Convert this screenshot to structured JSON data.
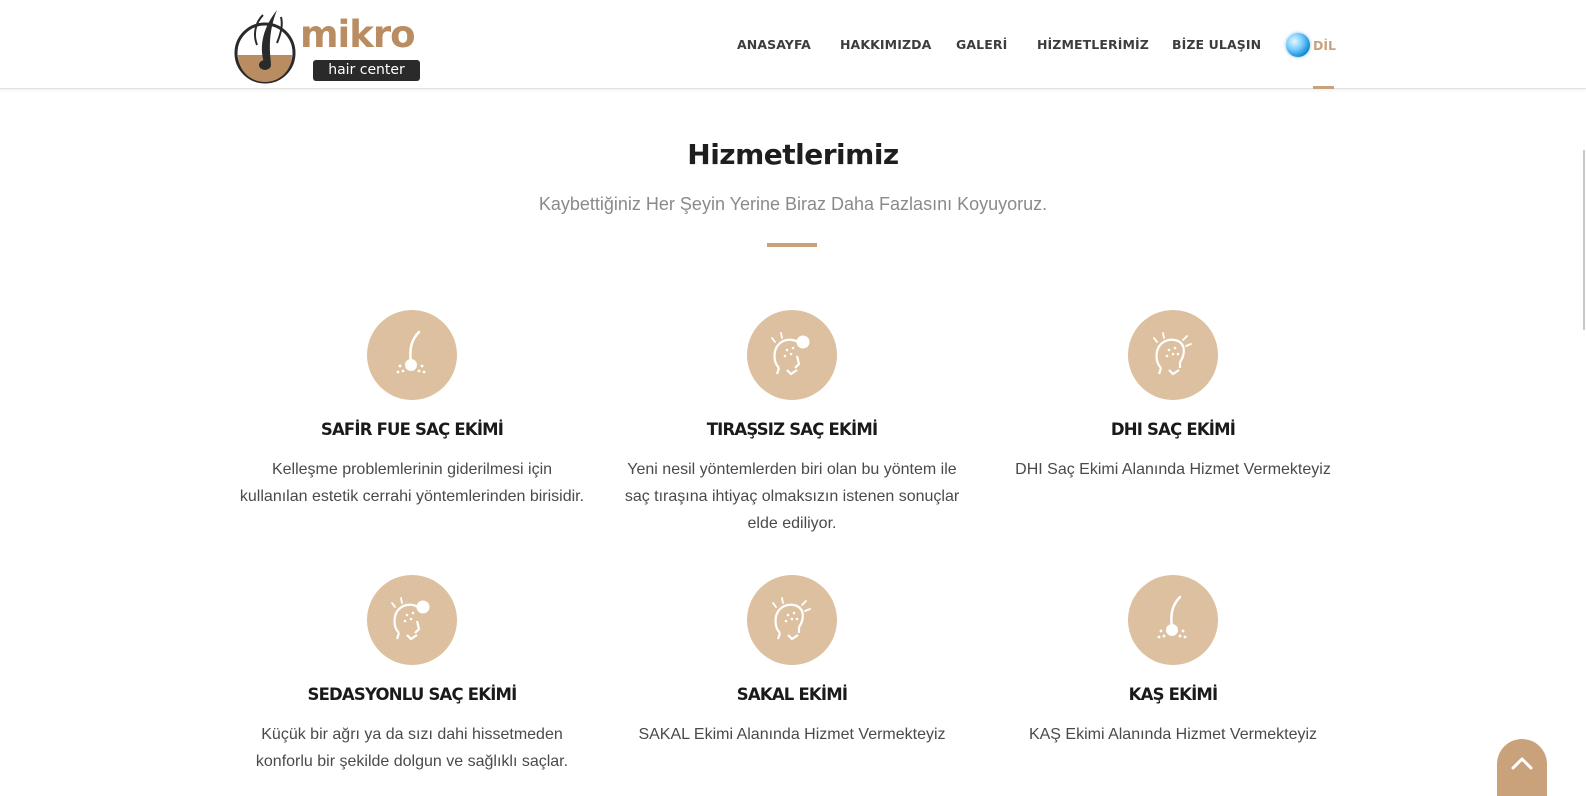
{
  "header": {
    "logo": {
      "word": "mikro",
      "tagline": "hair center"
    },
    "nav": [
      {
        "label": "ANASAYFA"
      },
      {
        "label": "HAKKIMIZDA"
      },
      {
        "label": "GALERİ"
      },
      {
        "label": "HİZMETLERİMİZ"
      },
      {
        "label": "BİZE ULAŞIN"
      }
    ],
    "language": {
      "label": "DİL",
      "icon": "globe-icon"
    }
  },
  "section": {
    "title": "Hizmetlerimiz",
    "subtitle": "Kaybettiğiniz Her Şeyin Yerine Biraz Daha Fazlasını Koyuyoruz."
  },
  "services": [
    {
      "title": "SAFİR FUE SAÇ EKİMİ",
      "description": "Kelleşme problemlerinin giderilmesi için kullanılan estetik cerrahi yöntemlerinden birisidir.",
      "icon": "hair-follicle-icon"
    },
    {
      "title": "TIRAŞSIZ SAÇ EKİMİ",
      "description": "Yeni nesil yöntemlerden biri olan bu yöntem ile saç tıraşına ihtiyaç olmaksızın istenen sonuçlar elde ediliyor.",
      "icon": "head-profile-dot-icon"
    },
    {
      "title": "DHI SAÇ EKİMİ",
      "description": "DHI Saç Ekimi Alanında Hizmet Vermekteyiz",
      "icon": "head-profile-icon"
    },
    {
      "title": "SEDASYONLU SAÇ EKİMİ",
      "description": "Küçük bir ağrı ya da sızı dahi hissetmeden konforlu bir şekilde dolgun ve sağlıklı saçlar.",
      "icon": "head-profile-dot-icon"
    },
    {
      "title": "SAKAL EKİMİ",
      "description": "SAKAL Ekimi Alanında Hizmet Vermekteyiz",
      "icon": "head-profile-icon"
    },
    {
      "title": "KAŞ EKİMİ",
      "description": "KAŞ Ekimi Alanında Hizmet Vermekteyiz",
      "icon": "hair-follicle-icon"
    }
  ],
  "colors": {
    "accent": "#c9a27c",
    "icon_circle": "#dcc0a0",
    "heading": "#1e1e1e",
    "subtitle": "#8a8a8a"
  },
  "scroll_top": {
    "icon": "chevron-up-icon"
  }
}
